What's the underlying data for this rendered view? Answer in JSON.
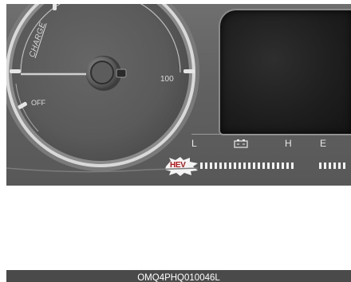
{
  "gauge": {
    "charge_label": "CHARGE",
    "max_label": "100",
    "off_label": "OFF"
  },
  "fuel_temp": {
    "low_label": "L",
    "high_label": "H",
    "empty_label": "E",
    "battery_icon": "battery-icon"
  },
  "warning": {
    "label": "HEV"
  },
  "caption": "OMQ4PHQ010046L",
  "colors": {
    "cluster_bg": "#616161",
    "screen_bg": "#1d1d1d",
    "warning_red": "#b0161a",
    "caption_bg": "#4a4a4a"
  }
}
